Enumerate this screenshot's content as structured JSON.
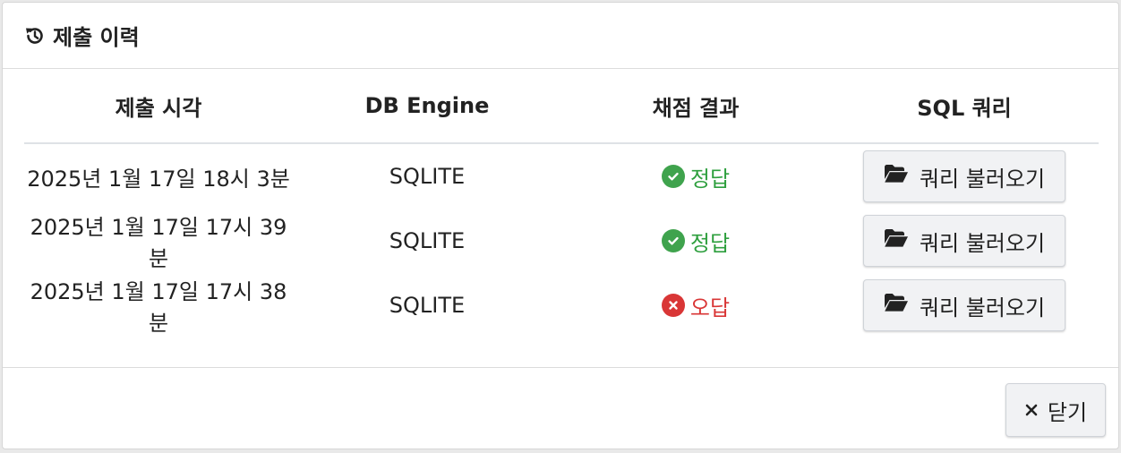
{
  "modal": {
    "title": "제출 이력",
    "title_icon": "history-icon"
  },
  "table": {
    "headers": [
      "제출 시각",
      "DB Engine",
      "채점 결과",
      "SQL 쿼리"
    ],
    "rows": [
      {
        "time": "2025년 1월 17일 18시 3분",
        "engine": "SQLITE",
        "result": "정답",
        "result_status": "correct",
        "action": "쿼리 불러오기"
      },
      {
        "time": "2025년 1월 17일 17시 39분",
        "engine": "SQLITE",
        "result": "정답",
        "result_status": "correct",
        "action": "쿼리 불러오기"
      },
      {
        "time": "2025년 1월 17일 17시 38분",
        "engine": "SQLITE",
        "result": "오답",
        "result_status": "wrong",
        "action": "쿼리 불러오기"
      }
    ]
  },
  "footer": {
    "close_label": "닫기",
    "close_icon": "close-icon"
  },
  "colors": {
    "correct": "#2e9f3e",
    "wrong": "#d93636"
  }
}
